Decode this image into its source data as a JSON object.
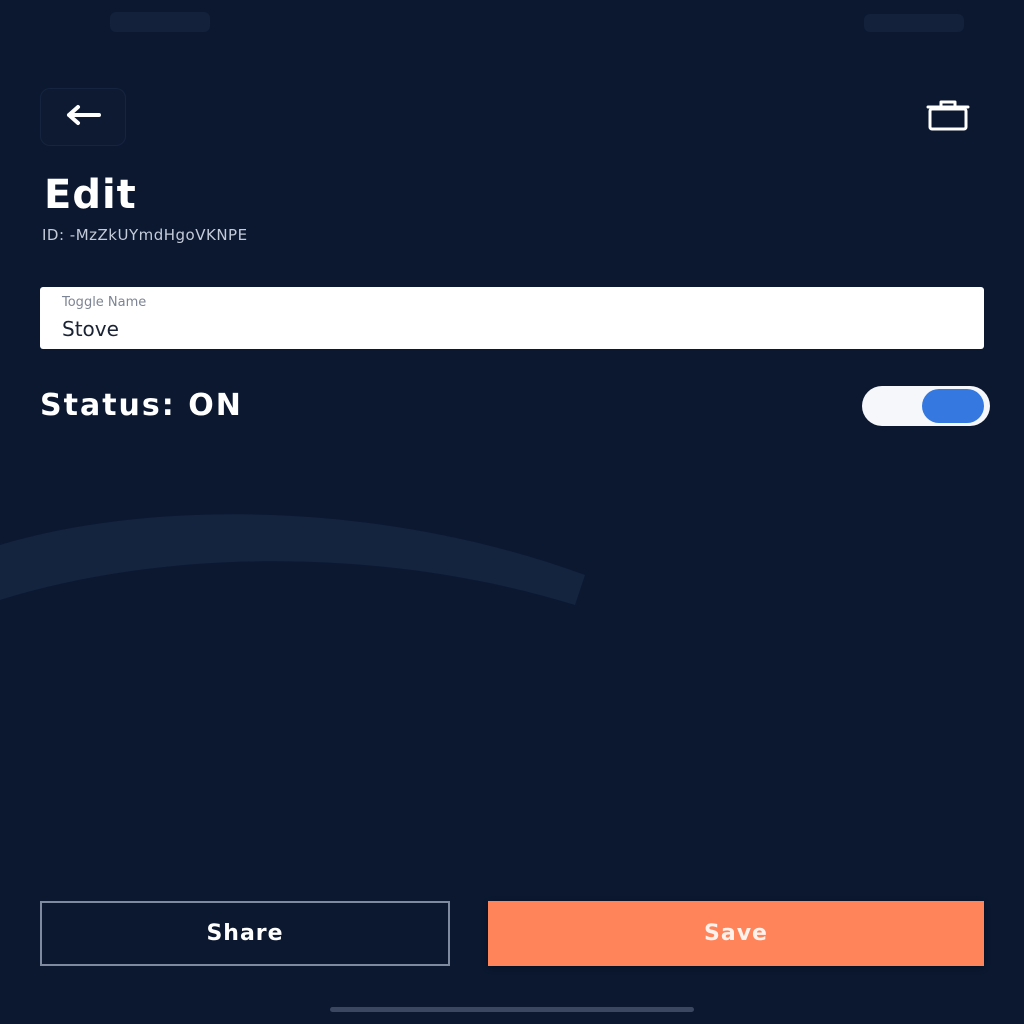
{
  "header": {
    "back_icon": "arrow-left-icon",
    "delete_icon": "trash-icon"
  },
  "page": {
    "title": "Edit",
    "record_id": "ID: -MzZkUYmdHgoVKNPE"
  },
  "form": {
    "name_field": {
      "label": "Toggle Name",
      "value": "Stove"
    },
    "status": {
      "label": "Status: ON",
      "is_on": true
    }
  },
  "actions": {
    "share_label": "Share",
    "save_label": "Save"
  },
  "colors": {
    "background": "#0b1830",
    "accent": "#ff8459",
    "toggle_knob": "#3478e0",
    "field_background": "#ffffff"
  }
}
